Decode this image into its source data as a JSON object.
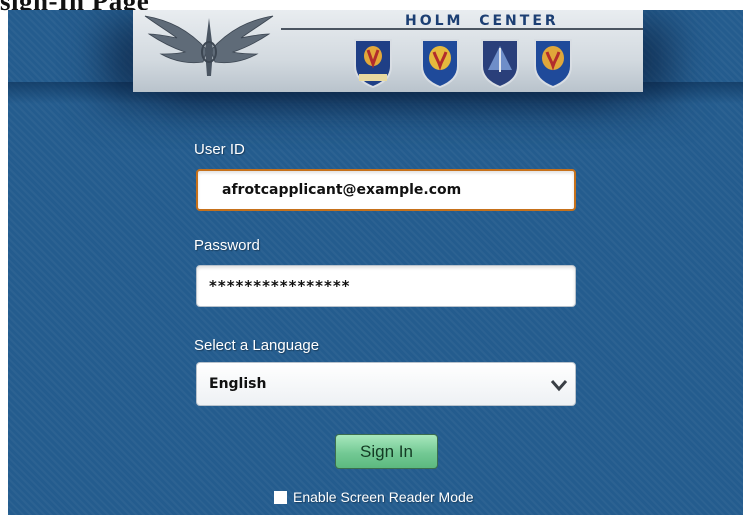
{
  "page": {
    "heading": "sign-In Page"
  },
  "banner": {
    "title": "HOLM  CENTER",
    "emblems": [
      "wings-emblem",
      "holm-center-seal",
      "afrotc-seal",
      "jrotc-seal",
      "oats-seal"
    ]
  },
  "form": {
    "user_id_label": "User ID",
    "user_id_value": "afrotcapplicant@example.com",
    "password_label": "Password",
    "password_value": "****************",
    "language_label": "Select a Language",
    "language_value": "English",
    "sign_in_label": "Sign In",
    "screen_reader_label": "Enable Screen Reader Mode"
  },
  "colors": {
    "panel_background": "#245c8e",
    "focus_border": "#c6711b",
    "sign_in_button": "#73c994"
  },
  "icons": {
    "select_arrow": "chevron-down-icon",
    "checkbox": "checkbox-icon"
  }
}
